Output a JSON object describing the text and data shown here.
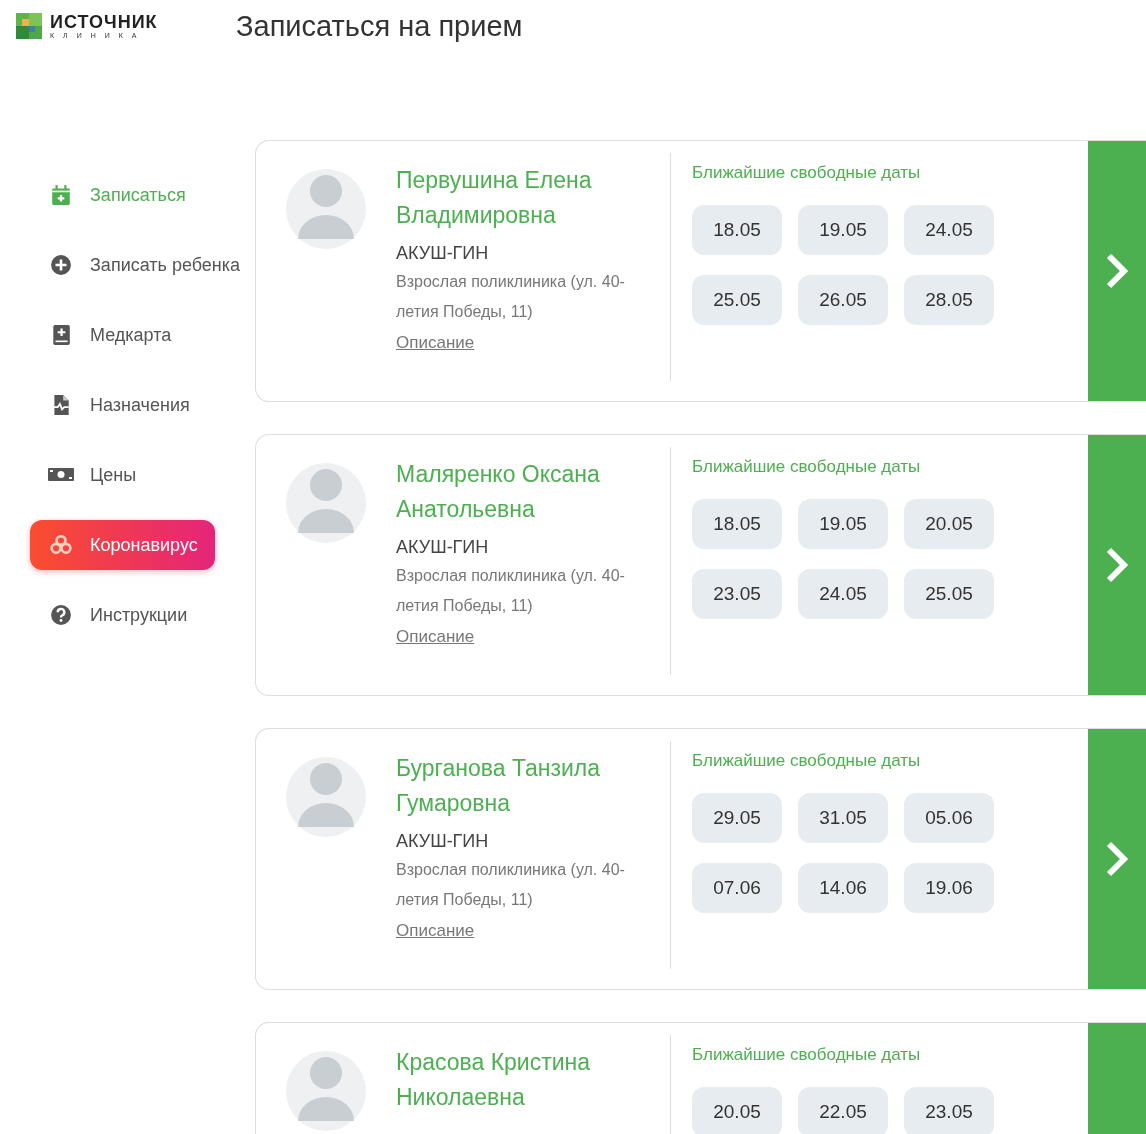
{
  "logo": {
    "name": "ИСТОЧНИК",
    "subtitle": "КЛИНИКА"
  },
  "page_title": "Записаться на прием",
  "sidebar": {
    "items": [
      {
        "label": "Записаться",
        "kind": "plain",
        "selected": true
      },
      {
        "label": "Записать ребенка",
        "kind": "plain",
        "selected": false
      },
      {
        "label": "Медкарта",
        "kind": "plain",
        "selected": false
      },
      {
        "label": "Назначения",
        "kind": "plain",
        "selected": false
      },
      {
        "label": "Цены",
        "kind": "plain",
        "selected": false
      },
      {
        "label": "Коронавирус",
        "kind": "highlight",
        "selected": false
      },
      {
        "label": "Инструкции",
        "kind": "plain",
        "selected": false
      }
    ]
  },
  "doctors": [
    {
      "name": "Первушина Елена Владимировна",
      "specialty": "АКУШ-ГИН",
      "address": "Взрослая поликлиника (ул. 40-летия Победы, 11)",
      "link": "Описание",
      "dates_title": "Ближайшие свободные даты",
      "dates": [
        "18.05",
        "19.05",
        "24.05",
        "25.05",
        "26.05",
        "28.05"
      ]
    },
    {
      "name": "Маляренко Оксана Анатольевна",
      "specialty": "АКУШ-ГИН",
      "address": "Взрослая поликлиника (ул. 40-летия Победы, 11)",
      "link": "Описание",
      "dates_title": "Ближайшие свободные даты",
      "dates": [
        "18.05",
        "19.05",
        "20.05",
        "23.05",
        "24.05",
        "25.05"
      ]
    },
    {
      "name": "Бурганова Танзила Гумаровна",
      "specialty": "АКУШ-ГИН",
      "address": "Взрослая поликлиника (ул. 40-летия Победы, 11)",
      "link": "Описание",
      "dates_title": "Ближайшие свободные даты",
      "dates": [
        "29.05",
        "31.05",
        "05.06",
        "07.06",
        "14.06",
        "19.06"
      ]
    },
    {
      "name": "Красова Кристина Николаевна",
      "dates_title": "Ближайшие свободные даты",
      "dates": [
        "20.05",
        "22.05",
        "23.05"
      ]
    }
  ]
}
